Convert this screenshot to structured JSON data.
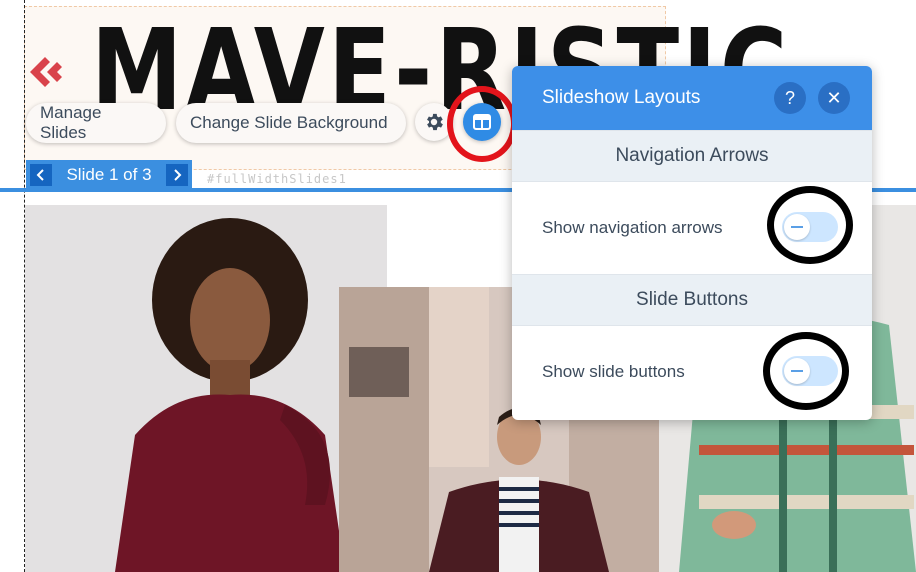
{
  "site": {
    "logo_text": "MAVE-RISTIC",
    "anchor_id": "#fullWidthSlides1"
  },
  "toolbar": {
    "manage_slides": "Manage Slides",
    "change_background": "Change Slide Background",
    "settings_icon": "gear-icon",
    "layouts_icon": "layout-icon"
  },
  "slide_nav": {
    "label": "Slide 1 of 3"
  },
  "panel": {
    "title": "Slideshow Layouts",
    "help": "?",
    "close": "✕",
    "sections": [
      {
        "heading": "Navigation Arrows",
        "row_label": "Show navigation arrows",
        "enabled": false
      },
      {
        "heading": "Slide Buttons",
        "row_label": "Show slide buttons",
        "enabled": false
      }
    ]
  },
  "colors": {
    "accent": "#3d8fe8",
    "highlight_red": "#e3141b",
    "highlight_black": "#000000"
  }
}
